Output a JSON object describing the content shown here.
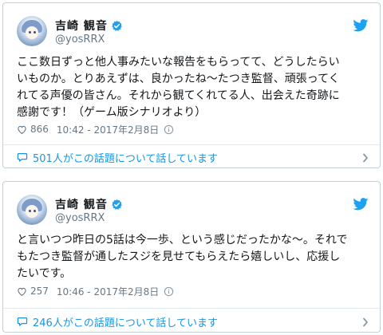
{
  "colors": {
    "accent": "#1da1f2",
    "link": "#1b95e0",
    "muted": "#657786",
    "text": "#14171a",
    "border": "#c4cfd6"
  },
  "tweets": [
    {
      "display_name": "吉崎 観音",
      "handle": "@yosRRX",
      "text": "ここ数日ずっと他人事みたいな報告をもらってて、どうしたらい\nいものか。とりあえずは、良かったね〜たつき監督、頑張ってく\nれてる声優の皆さん。それから観てくれてる人、出会えた奇跡に\n感謝です！（ゲーム版シナリオより）",
      "likes": "866",
      "timestamp": "10:42 - 2017年2月8日",
      "talking": "501人がこの話題について話しています",
      "icons": [
        "verified-badge-icon",
        "twitter-bird-icon",
        "heart-icon",
        "info-icon",
        "speech-bubble-icon",
        "chevron-right-icon"
      ]
    },
    {
      "display_name": "吉崎 観音",
      "handle": "@yosRRX",
      "text": "と言いつつ昨日の5話は今一歩、という感じだったかな〜。それで\nもたつき監督が通したスジを見せてもらえたら嬉しいし、応援し\nたいです。",
      "likes": "257",
      "timestamp": "10:46 - 2017年2月8日",
      "talking": "246人がこの話題について話しています",
      "icons": [
        "verified-badge-icon",
        "twitter-bird-icon",
        "heart-icon",
        "info-icon",
        "speech-bubble-icon",
        "chevron-right-icon"
      ]
    }
  ]
}
